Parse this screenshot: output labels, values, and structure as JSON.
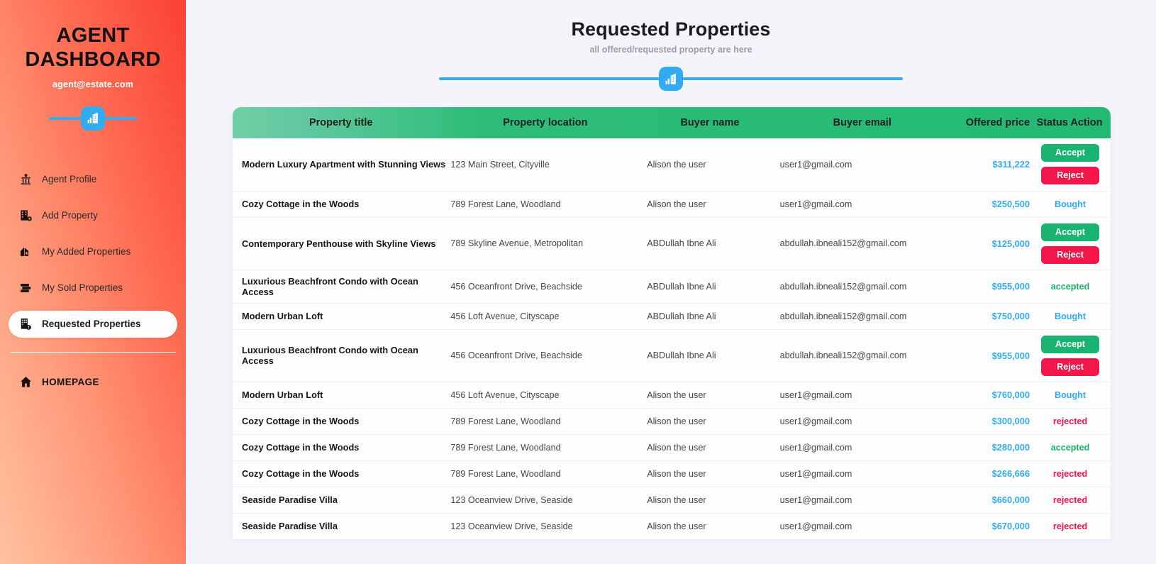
{
  "sidebar": {
    "brand_title": "AGENT DASHBOARD",
    "brand_email": "agent@estate.com",
    "logo_icon": "building-chart-icon",
    "items": [
      {
        "label": "Agent Profile",
        "icon": "agent-profile-icon",
        "active": false
      },
      {
        "label": "Add Property",
        "icon": "add-property-icon",
        "active": false
      },
      {
        "label": "My Added Properties",
        "icon": "house-icon",
        "active": false
      },
      {
        "label": "My Sold Properties",
        "icon": "stack-icon",
        "active": false
      },
      {
        "label": "Requested Properties",
        "icon": "requested-properties-icon",
        "active": true
      }
    ],
    "homepage": {
      "label": "HOMEPAGE",
      "icon": "home-icon"
    }
  },
  "header": {
    "title": "Requested Properties",
    "subtitle": "all offered/requested property are here",
    "divider_icon": "building-chart-icon"
  },
  "colors": {
    "accent_blue": "#33abf0",
    "header_green_start": "#6fcfa4",
    "header_green_end": "#22ba72",
    "accept_green": "#1bb372",
    "reject_red": "#f3164a",
    "sidebar_gradient_start": "#ffc2a0",
    "sidebar_gradient_end": "#fa4032",
    "page_background": "#f4f4fa"
  },
  "table": {
    "columns": [
      "Property title",
      "Property location",
      "Buyer name",
      "Buyer email",
      "Offered price",
      "Status Action"
    ],
    "buttons": {
      "accept_label": "Accept",
      "reject_label": "Reject"
    },
    "rows": [
      {
        "title": "Modern Luxury Apartment with Stunning Views",
        "location": "123 Main Street, Cityville",
        "buyer": "Alison the user",
        "email": "user1@gmail.com",
        "price": "$311,222",
        "status_type": "actions",
        "status": ""
      },
      {
        "title": "Cozy Cottage in the Woods",
        "location": "789 Forest Lane, Woodland",
        "buyer": "Alison the user",
        "email": "user1@gmail.com",
        "price": "$250,500",
        "status_type": "bought",
        "status": "Bought"
      },
      {
        "title": "Contemporary Penthouse with Skyline Views",
        "location": "789 Skyline Avenue, Metropolitan",
        "buyer": "ABDullah Ibne Ali",
        "email": "abdullah.ibneali152@gmail.com",
        "price": "$125,000",
        "status_type": "actions",
        "status": ""
      },
      {
        "title": "Luxurious Beachfront Condo with Ocean Access",
        "location": "456 Oceanfront Drive, Beachside",
        "buyer": "ABDullah Ibne Ali",
        "email": "abdullah.ibneali152@gmail.com",
        "price": "$955,000",
        "status_type": "accepted",
        "status": "accepted"
      },
      {
        "title": "Modern Urban Loft",
        "location": "456 Loft Avenue, Cityscape",
        "buyer": "ABDullah Ibne Ali",
        "email": "abdullah.ibneali152@gmail.com",
        "price": "$750,000",
        "status_type": "bought",
        "status": "Bought"
      },
      {
        "title": "Luxurious Beachfront Condo with Ocean Access",
        "location": "456 Oceanfront Drive, Beachside",
        "buyer": "ABDullah Ibne Ali",
        "email": "abdullah.ibneali152@gmail.com",
        "price": "$955,000",
        "status_type": "actions",
        "status": ""
      },
      {
        "title": "Modern Urban Loft",
        "location": "456 Loft Avenue, Cityscape",
        "buyer": "Alison the user",
        "email": "user1@gmail.com",
        "price": "$760,000",
        "status_type": "bought",
        "status": "Bought"
      },
      {
        "title": "Cozy Cottage in the Woods",
        "location": "789 Forest Lane, Woodland",
        "buyer": "Alison the user",
        "email": "user1@gmail.com",
        "price": "$300,000",
        "status_type": "rejected",
        "status": "rejected"
      },
      {
        "title": "Cozy Cottage in the Woods",
        "location": "789 Forest Lane, Woodland",
        "buyer": "Alison the user",
        "email": "user1@gmail.com",
        "price": "$280,000",
        "status_type": "accepted",
        "status": "accepted"
      },
      {
        "title": "Cozy Cottage in the Woods",
        "location": "789 Forest Lane, Woodland",
        "buyer": "Alison the user",
        "email": "user1@gmail.com",
        "price": "$266,666",
        "status_type": "rejected",
        "status": "rejected"
      },
      {
        "title": "Seaside Paradise Villa",
        "location": "123 Oceanview Drive, Seaside",
        "buyer": "Alison the user",
        "email": "user1@gmail.com",
        "price": "$660,000",
        "status_type": "rejected",
        "status": "rejected"
      },
      {
        "title": "Seaside Paradise Villa",
        "location": "123 Oceanview Drive, Seaside",
        "buyer": "Alison the user",
        "email": "user1@gmail.com",
        "price": "$670,000",
        "status_type": "rejected",
        "status": "rejected"
      }
    ]
  }
}
